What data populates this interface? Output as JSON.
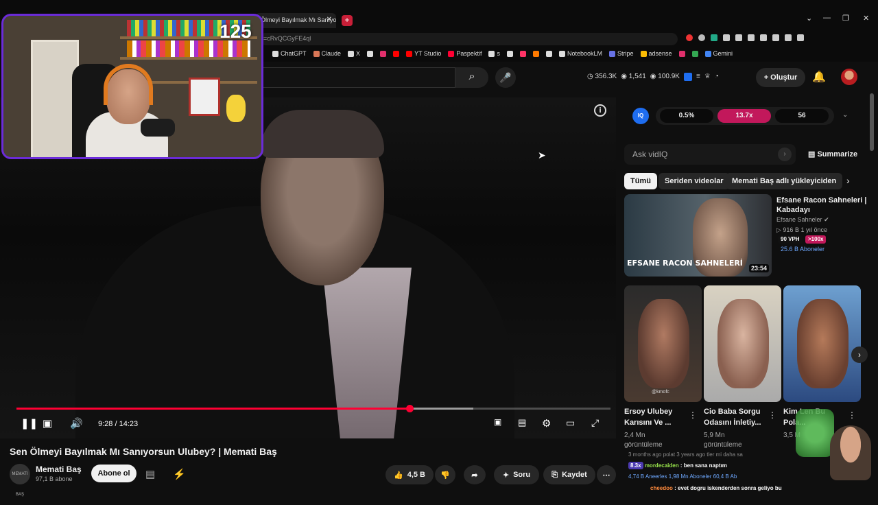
{
  "browser": {
    "tab_title": "Ölmeyi Bayılmak Mı Sanıyor",
    "tab_close": "✕",
    "new_tab": "+",
    "window_controls": [
      "⌄",
      "—",
      "❐",
      "✕"
    ],
    "url": "=cRvQCGyFE4ql",
    "bookmarks": [
      "ChatGPT",
      "Claude",
      "X",
      "",
      "",
      "",
      "YT Studio",
      "Paspektif",
      "s",
      "",
      "",
      "",
      "",
      "NotebookLM",
      "Stripe",
      "adsense",
      "",
      "",
      "Gemini"
    ],
    "bookmark_colors": [
      "#ddd",
      "#d97757",
      "#ddd",
      "#ddd",
      "#e1306c",
      "#ff0000",
      "#ff0000",
      "#ff0033",
      "#ddd",
      "#ddd",
      "#ff3366",
      "#ff7a00",
      "#ddd",
      "#ddd",
      "#6772e5",
      "#fbbc04",
      "#e1306c",
      "#34a853",
      "#4285f4"
    ]
  },
  "header": {
    "stats": [
      "356.3K",
      "1,541",
      "100.9K"
    ],
    "create_label": "Oluştur",
    "bell_icon": "🔔",
    "search_icon": "⌕",
    "mic_icon": "🎤"
  },
  "player": {
    "time": "9:28 / 14:23",
    "progress_fraction": 0.662,
    "buffered_fraction": 0.769,
    "info_icon": "i"
  },
  "video": {
    "title": "Sen Ölmeyi Bayılmak Mı Sanıyorsun Ulubey? | Memati Baş",
    "channel_name": "Memati Baş",
    "channel_avatar_text": "MEMATİ BAŞ",
    "subscribers": "97,1 B abone",
    "subscribe_label": "Abone ol",
    "like_count": "4,5 B",
    "ask_label": "Soru",
    "save_label": "Kaydet"
  },
  "vidiq": {
    "badge": "IQ",
    "metrics": [
      "0.5%",
      "13.7x",
      "56"
    ],
    "ask_placeholder": "Ask vidIQ",
    "summarize_label": "Summarize"
  },
  "chips": [
    "Tümü",
    "Seriden videolar",
    "Memati Baş adlı yükleyiciden"
  ],
  "recommended": {
    "title": "Efsane Racon Sahneleri | Kabadayı",
    "channel": "Efsane Sahneler",
    "meta": "▷ 916 B   1 yıl önce",
    "vph": "90 VPH",
    "ratio": ">100x",
    "subs": "25.6 B Aboneler",
    "thumb_label": "EFSANE RACON SAHNELERİ",
    "duration": "23:54"
  },
  "shorts": [
    {
      "title": "Ersoy Ulubey Karısını Ve ...",
      "views": "2,4 Mn",
      "views_label": "görüntüleme",
      "watermark": "@kmofc"
    },
    {
      "title": "Cio Baba Sorgu Odasını İnletiy...",
      "views": "5,9 Mn",
      "views_label": "görüntüleme",
      "watermark": ""
    },
    {
      "title": "Kim Len Bu Pola...",
      "views": "3,5 M",
      "views_label": "",
      "watermark": ""
    }
  ],
  "chat": [
    {
      "user": "",
      "text": "3 months ago   polat  3 years ago   tler mi daha sa"
    },
    {
      "user": "mordecaiden",
      "text": ": ben sana naptım",
      "badge": "8.3x"
    },
    {
      "user": "",
      "text": "4,74 B  Aneerles    1,98 Mn Aboneler    60,4 B Ab"
    },
    {
      "user": "cheedoo",
      "text": ": evet dogru iskenderden sonra geliyo bu"
    }
  ],
  "stream_overlay": {
    "counter": "125"
  },
  "colors": {
    "accent_red": "#ff0033",
    "vidiq_pink": "#c2185b",
    "vidiq_blue": "#1e6df0",
    "webcam_border": "#6b2bd9"
  }
}
